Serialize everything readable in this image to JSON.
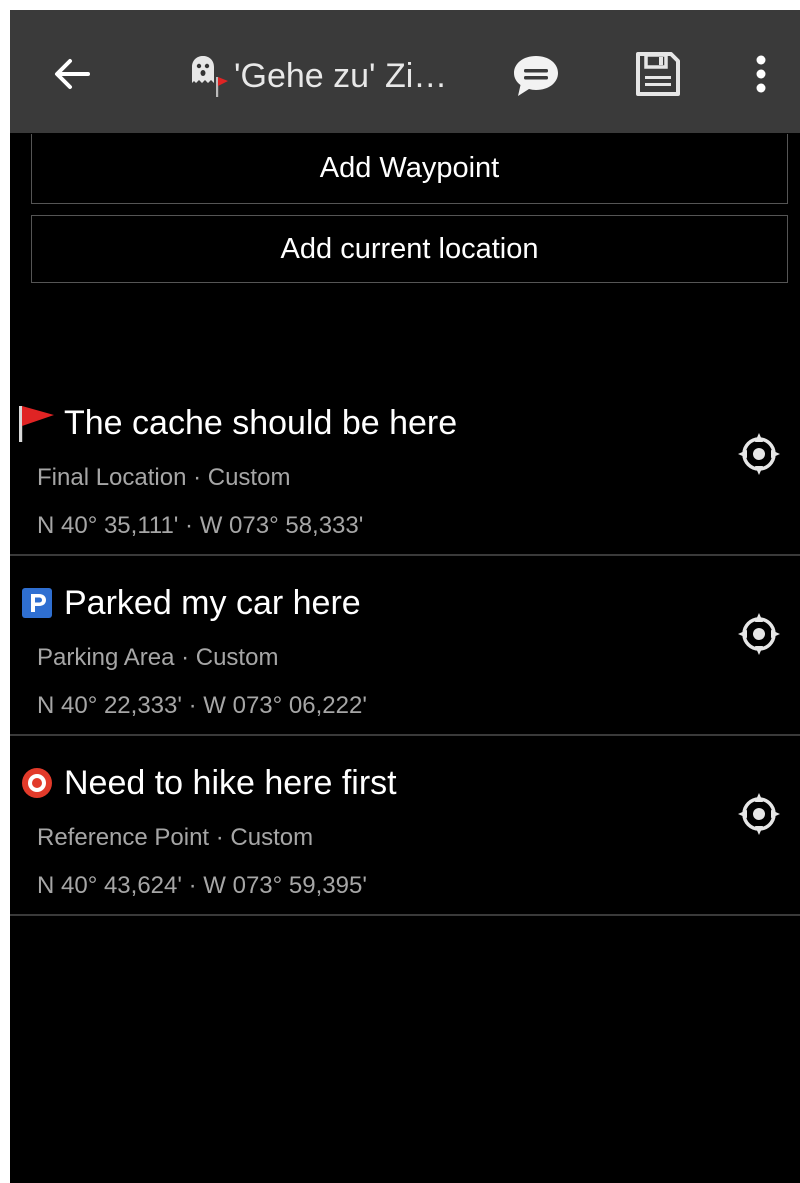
{
  "header": {
    "title": "'Gehe zu' Zi…",
    "back_icon": "back-arrow-icon",
    "cache_icon": "ghost-cache-icon",
    "chat_icon": "chat-bubble-icon",
    "save_icon": "save-icon",
    "more_icon": "more-vertical-icon",
    "background_color": "#3a3a3a"
  },
  "actions": {
    "add_waypoint_label": "Add Waypoint",
    "add_current_location_label": "Add current location"
  },
  "waypoints": [
    {
      "icon": "red-flag-icon",
      "title": "The cache should be here",
      "type_line": "Final Location · Custom",
      "coords": "N 40° 35,111' · W 073° 58,333'",
      "nav_icon": "navigate-crosshair-icon"
    },
    {
      "icon": "parking-icon",
      "title": "Parked my car here",
      "type_line": "Parking Area · Custom",
      "coords": "N 40° 22,333' · W 073° 06,222'",
      "nav_icon": "navigate-crosshair-icon"
    },
    {
      "icon": "reference-point-icon",
      "title": "Need to hike here first",
      "type_line": "Reference Point · Custom",
      "coords": "N 40° 43,624' · W 073° 59,395'",
      "nav_icon": "navigate-crosshair-icon"
    }
  ],
  "colors": {
    "background": "#000000",
    "primary_text": "#ffffff",
    "secondary_text": "#a6a6a6",
    "divider": "#3a3a3a",
    "flag_red": "#e02424",
    "parking_blue": "#2f6fd1",
    "reference_red": "#e23a2a"
  }
}
